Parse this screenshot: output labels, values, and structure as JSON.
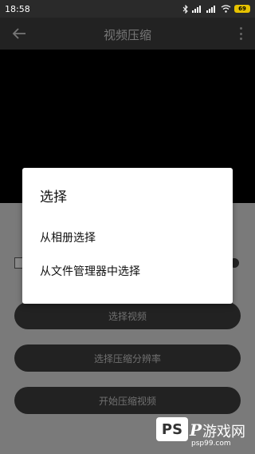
{
  "status_bar": {
    "time": "18:58",
    "battery": "69"
  },
  "app_bar": {
    "title": "视频压缩"
  },
  "buttons": {
    "select_video": "选择视频",
    "select_resolution": "选择压缩分辨率",
    "start_compress": "开始压缩视频"
  },
  "dialog": {
    "title": "选择",
    "options": [
      "从相册选择",
      "从文件管理器中选择"
    ]
  },
  "watermark": {
    "logo_text": "PS",
    "p": "P",
    "name": "游戏网",
    "url": "psp99.com"
  },
  "colors": {
    "app_bar": "#222222",
    "background": "#7a7a7a",
    "button": "#222222",
    "dialog": "#ffffff"
  }
}
